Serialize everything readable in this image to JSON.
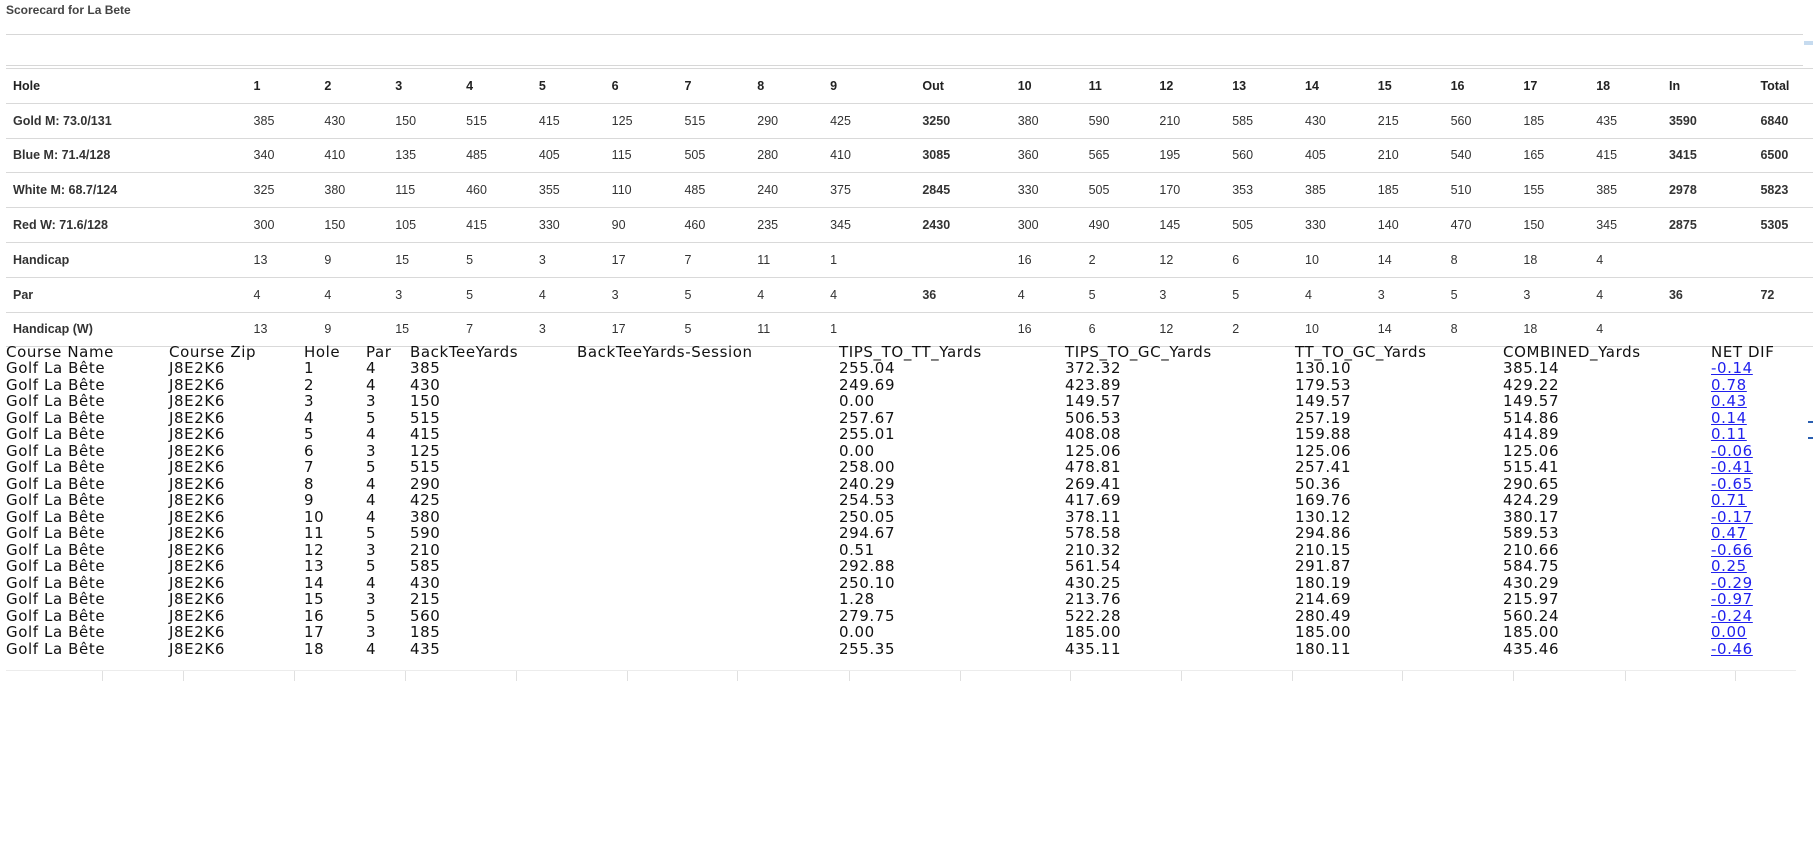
{
  "title": "Scorecard for La Bete",
  "scorecard": {
    "header": [
      "Hole",
      "1",
      "2",
      "3",
      "4",
      "5",
      "6",
      "7",
      "8",
      "9",
      "Out",
      "10",
      "11",
      "12",
      "13",
      "14",
      "15",
      "16",
      "17",
      "18",
      "In",
      "Total"
    ],
    "rows": [
      {
        "label": "Gold M: 73.0/131",
        "cells": [
          "385",
          "430",
          "150",
          "515",
          "415",
          "125",
          "515",
          "290",
          "425",
          "3250",
          "380",
          "590",
          "210",
          "585",
          "430",
          "215",
          "560",
          "185",
          "435",
          "3590",
          "6840"
        ]
      },
      {
        "label": "Blue M: 71.4/128",
        "cells": [
          "340",
          "410",
          "135",
          "485",
          "405",
          "115",
          "505",
          "280",
          "410",
          "3085",
          "360",
          "565",
          "195",
          "560",
          "405",
          "210",
          "540",
          "165",
          "415",
          "3415",
          "6500"
        ]
      },
      {
        "label": "White M: 68.7/124",
        "cells": [
          "325",
          "380",
          "115",
          "460",
          "355",
          "110",
          "485",
          "240",
          "375",
          "2845",
          "330",
          "505",
          "170",
          "353",
          "385",
          "185",
          "510",
          "155",
          "385",
          "2978",
          "5823"
        ]
      },
      {
        "label": "Red W: 71.6/128",
        "cells": [
          "300",
          "150",
          "105",
          "415",
          "330",
          "90",
          "460",
          "235",
          "345",
          "2430",
          "300",
          "490",
          "145",
          "505",
          "330",
          "140",
          "470",
          "150",
          "345",
          "2875",
          "5305"
        ]
      },
      {
        "label": "Handicap",
        "cells": [
          "13",
          "9",
          "15",
          "5",
          "3",
          "17",
          "7",
          "11",
          "1",
          "",
          "16",
          "2",
          "12",
          "6",
          "10",
          "14",
          "8",
          "18",
          "4",
          "",
          ""
        ]
      },
      {
        "label": "Par",
        "cells": [
          "4",
          "4",
          "3",
          "5",
          "4",
          "3",
          "5",
          "4",
          "4",
          "36",
          "4",
          "5",
          "3",
          "5",
          "4",
          "3",
          "5",
          "3",
          "4",
          "36",
          "72"
        ]
      },
      {
        "label": "Handicap (W)",
        "cells": [
          "13",
          "9",
          "15",
          "7",
          "3",
          "17",
          "5",
          "11",
          "1",
          "",
          "16",
          "6",
          "12",
          "2",
          "10",
          "14",
          "8",
          "18",
          "4",
          "",
          ""
        ]
      }
    ]
  },
  "grid": {
    "columns": [
      "Course Name",
      "Course Zip",
      "Hole",
      "Par",
      "BackTeeYards",
      "BackTeeYards-Session",
      "TIPS_TO_TT_Yards",
      "TIPS_TO_GC_Yards",
      "TT_TO_GC_Yards",
      "COMBINED_Yards",
      "NET DIF"
    ],
    "rows": [
      [
        "Golf La Bête",
        "J8E2K6",
        "1",
        "4",
        "385",
        "",
        "255.04",
        "372.32",
        "130.10",
        "385.14",
        "-0.14"
      ],
      [
        "Golf La Bête",
        "J8E2K6",
        "2",
        "4",
        "430",
        "",
        "249.69",
        "423.89",
        "179.53",
        "429.22",
        "0.78"
      ],
      [
        "Golf La Bête",
        "J8E2K6",
        "3",
        "3",
        "150",
        "",
        "0.00",
        "149.57",
        "149.57",
        "149.57",
        "0.43"
      ],
      [
        "Golf La Bête",
        "J8E2K6",
        "4",
        "5",
        "515",
        "",
        "257.67",
        "506.53",
        "257.19",
        "514.86",
        "0.14"
      ],
      [
        "Golf La Bête",
        "J8E2K6",
        "5",
        "4",
        "415",
        "",
        "255.01",
        "408.08",
        "159.88",
        "414.89",
        "0.11"
      ],
      [
        "Golf La Bête",
        "J8E2K6",
        "6",
        "3",
        "125",
        "",
        "0.00",
        "125.06",
        "125.06",
        "125.06",
        "-0.06"
      ],
      [
        "Golf La Bête",
        "J8E2K6",
        "7",
        "5",
        "515",
        "",
        "258.00",
        "478.81",
        "257.41",
        "515.41",
        "-0.41"
      ],
      [
        "Golf La Bête",
        "J8E2K6",
        "8",
        "4",
        "290",
        "",
        "240.29",
        "269.41",
        "50.36",
        "290.65",
        "-0.65"
      ],
      [
        "Golf La Bête",
        "J8E2K6",
        "9",
        "4",
        "425",
        "",
        "254.53",
        "417.69",
        "169.76",
        "424.29",
        "0.71"
      ],
      [
        "Golf La Bête",
        "J8E2K6",
        "10",
        "4",
        "380",
        "",
        "250.05",
        "378.11",
        "130.12",
        "380.17",
        "-0.17"
      ],
      [
        "Golf La Bête",
        "J8E2K6",
        "11",
        "5",
        "590",
        "",
        "294.67",
        "578.58",
        "294.86",
        "589.53",
        "0.47"
      ],
      [
        "Golf La Bête",
        "J8E2K6",
        "12",
        "3",
        "210",
        "",
        "0.51",
        "210.32",
        "210.15",
        "210.66",
        "-0.66"
      ],
      [
        "Golf La Bête",
        "J8E2K6",
        "13",
        "5",
        "585",
        "",
        "292.88",
        "561.54",
        "291.87",
        "584.75",
        "0.25"
      ],
      [
        "Golf La Bête",
        "J8E2K6",
        "14",
        "4",
        "430",
        "",
        "250.10",
        "430.25",
        "180.19",
        "430.29",
        "-0.29"
      ],
      [
        "Golf La Bête",
        "J8E2K6",
        "15",
        "3",
        "215",
        "",
        "1.28",
        "213.76",
        "214.69",
        "215.97",
        "-0.97"
      ],
      [
        "Golf La Bête",
        "J8E2K6",
        "16",
        "5",
        "560",
        "",
        "279.75",
        "522.28",
        "280.49",
        "560.24",
        "-0.24"
      ],
      [
        "Golf La Bête",
        "J8E2K6",
        "17",
        "3",
        "185",
        "",
        "0.00",
        "185.00",
        "185.00",
        "185.00",
        "0.00"
      ],
      [
        "Golf La Bête",
        "J8E2K6",
        "18",
        "4",
        "435",
        "",
        "255.35",
        "435.11",
        "180.11",
        "435.46",
        "-0.46"
      ]
    ]
  },
  "colors": {
    "link": "#2020ee",
    "rule": "#d9d9d9"
  }
}
